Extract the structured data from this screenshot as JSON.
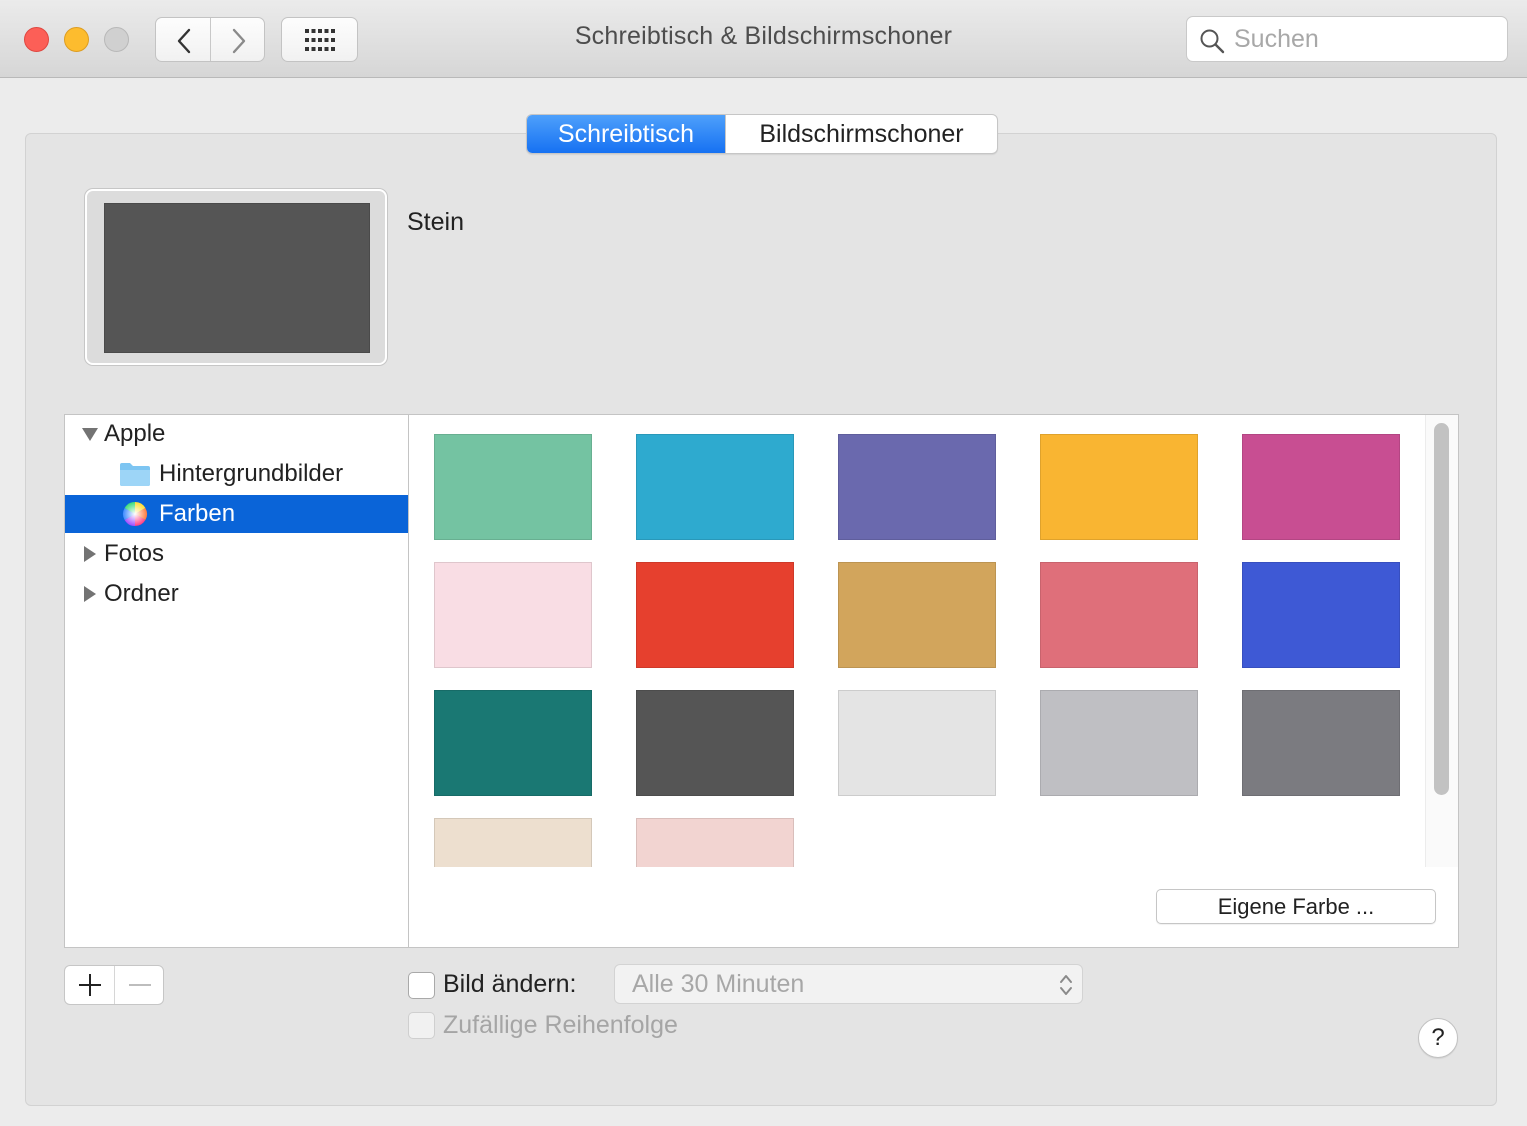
{
  "window": {
    "title": "Schreibtisch & Bildschirmschoner",
    "search_placeholder": "Suchen"
  },
  "tabs": [
    {
      "label": "Schreibtisch",
      "active": true
    },
    {
      "label": "Bildschirmschoner",
      "active": false
    }
  ],
  "preview": {
    "name": "Stein",
    "color": "#555555"
  },
  "sidebar": {
    "items": [
      {
        "label": "Apple",
        "type": "group",
        "expanded": true,
        "icon": "disclosure-down-icon"
      },
      {
        "label": "Hintergrundbilder",
        "type": "child",
        "icon": "folder-icon"
      },
      {
        "label": "Farben",
        "type": "child",
        "icon": "color-wheel-icon",
        "selected": true
      },
      {
        "label": "Fotos",
        "type": "group",
        "expanded": false,
        "icon": "disclosure-right-icon"
      },
      {
        "label": "Ordner",
        "type": "group",
        "expanded": false,
        "icon": "disclosure-right-icon"
      }
    ]
  },
  "colors": [
    "#74c3a2",
    "#2eaacf",
    "#6a69ae",
    "#f9b532",
    "#c84e92",
    "#f9dde4",
    "#e6402e",
    "#d2a55c",
    "#df6f7a",
    "#3e59d5",
    "#1a7873",
    "#555555",
    "#e4e4e4",
    "#bfbfc3",
    "#7b7b80",
    "#eddfcf",
    "#f2d4d1"
  ],
  "custom_color_button": "Eigene Farbe ...",
  "change_picture": {
    "label": "Bild ändern:",
    "checked": false
  },
  "interval": {
    "value": "Alle 30 Minuten"
  },
  "random_order": {
    "label": "Zufällige Reihenfolge",
    "checked": false,
    "enabled": false
  },
  "help_label": "?"
}
